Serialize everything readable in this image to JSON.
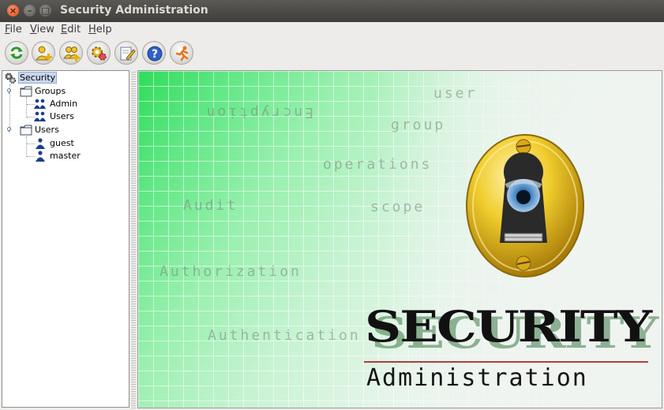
{
  "window": {
    "title": "Security Administration",
    "buttons": {
      "close": "×",
      "minimize": "–",
      "maximize": "□"
    }
  },
  "menubar": {
    "items": [
      {
        "label": "File",
        "mnemonic_index": 0
      },
      {
        "label": "View",
        "mnemonic_index": 0
      },
      {
        "label": "Edit",
        "mnemonic_index": 0
      },
      {
        "label": "Help",
        "mnemonic_index": 0
      }
    ]
  },
  "toolbar": {
    "buttons": [
      {
        "icon": "refresh-icon"
      },
      {
        "icon": "add-user-icon"
      },
      {
        "icon": "add-group-icon"
      },
      {
        "icon": "add-operation-icon"
      },
      {
        "icon": "edit-properties-icon"
      },
      {
        "icon": "help-icon"
      },
      {
        "icon": "exit-icon"
      }
    ]
  },
  "tree": {
    "root": {
      "label": "Security",
      "selected": true
    },
    "groups": {
      "label": "Groups",
      "children": [
        "Admin",
        "Users"
      ]
    },
    "users": {
      "label": "Users",
      "children": [
        "guest",
        "master"
      ]
    }
  },
  "banner": {
    "words": [
      "user",
      "Encryption",
      "group",
      "operations",
      "Audit",
      "scope",
      "Authorization",
      "Authentication"
    ],
    "brand_title": "SECURITY",
    "brand_subtitle": "Administration"
  },
  "colors": {
    "titlebar": "#3f3e3a",
    "accent_green": "#2edc5a",
    "gold": "#e8c12a",
    "selection": "#c8d7ef"
  }
}
